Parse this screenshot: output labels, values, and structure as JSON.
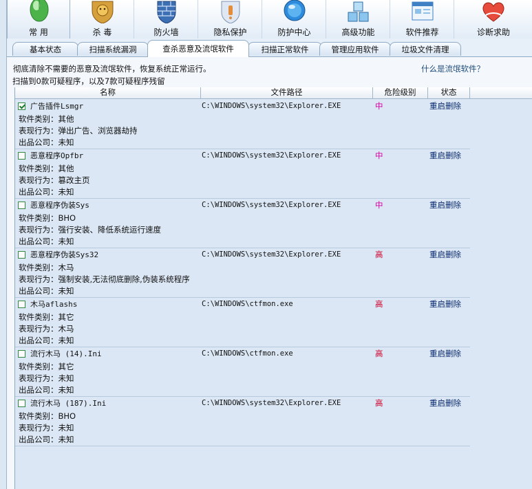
{
  "toolbar": {
    "buttons": [
      {
        "label": "常 用",
        "icon": "mouse-icon",
        "color": "#4cb34a"
      },
      {
        "label": "杀 毒",
        "icon": "lion-shield-icon",
        "color": "#d6a13c"
      },
      {
        "label": "防火墙",
        "icon": "firewall-brick-icon",
        "color": "#3c6fb4"
      },
      {
        "label": "隐私保护",
        "icon": "privacy-shield-icon",
        "color": "#e38c3a"
      },
      {
        "label": "防护中心",
        "icon": "protection-globe-icon",
        "color": "#2e8bdc"
      },
      {
        "label": "高级功能",
        "icon": "cubes-icon",
        "color": "#5aa4d8"
      },
      {
        "label": "软件推荐",
        "icon": "window-icon",
        "color": "#3f7fc4"
      },
      {
        "label": "诊断求助",
        "icon": "help-heart-icon",
        "color": "#e64b3b"
      }
    ]
  },
  "tabs": [
    "基本状态",
    "扫描系统漏洞",
    "查杀恶意及流氓软件",
    "扫描正常软件",
    "管理应用软件",
    "垃圾文件清理"
  ],
  "active_tab": 2,
  "info": {
    "description": "彻底清除不需要的恶意及流氓软件，恢复系统正常运行。",
    "summary": "扫描到0款可疑程序，以及7款可疑程序残留",
    "help_link": "什么是流氓软件？"
  },
  "table": {
    "headers": [
      "名称",
      "文件路径",
      "危险级别",
      "状态"
    ],
    "rows": [
      {
        "checked": true,
        "name": "广告插件Lsmgr",
        "category": "软件类别：其他",
        "behavior": "表现行为：弹出广告、浏览器劫持",
        "company": "出品公司：未知",
        "path": "C:\\WINDOWS\\system32\\Explorer.EXE",
        "risk": "中",
        "risk_level": "mid",
        "status": "重启删除"
      },
      {
        "checked": false,
        "name": "恶意程序Opfbr",
        "category": "软件类别：其他",
        "behavior": "表现行为：篡改主页",
        "company": "出品公司：未知",
        "path": "C:\\WINDOWS\\system32\\Explorer.EXE",
        "risk": "中",
        "risk_level": "mid",
        "status": "重启删除"
      },
      {
        "checked": false,
        "name": "恶意程序伪装Sys",
        "category": "软件类别：BHO",
        "behavior": "表现行为：强行安装、降低系统运行速度",
        "company": "出品公司：未知",
        "path": "C:\\WINDOWS\\system32\\Explorer.EXE",
        "risk": "中",
        "risk_level": "mid",
        "status": "重启删除"
      },
      {
        "checked": false,
        "name": "恶意程序伪装Sys32",
        "category": "软件类别：木马",
        "behavior": "表现行为：强制安装,无法彻底删除,伪装系统程序",
        "company": "出品公司：未知",
        "path": "C:\\WINDOWS\\system32\\Explorer.EXE",
        "risk": "高",
        "risk_level": "high",
        "status": "重启删除"
      },
      {
        "checked": false,
        "name": "木马aflashs",
        "category": "软件类别：其它",
        "behavior": "表现行为：木马",
        "company": "出品公司：未知",
        "path": "C:\\WINDOWS\\ctfmon.exe",
        "risk": "高",
        "risk_level": "high",
        "status": "重启删除"
      },
      {
        "checked": false,
        "name": "流行木马 (14).Ini",
        "category": "软件类别：其它",
        "behavior": "表现行为：未知",
        "company": "出品公司：未知",
        "path": "C:\\WINDOWS\\ctfmon.exe",
        "risk": "高",
        "risk_level": "high",
        "status": "重启删除"
      },
      {
        "checked": false,
        "name": "流行木马 (187).Ini",
        "category": "软件类别：BHO",
        "behavior": "表现行为：未知",
        "company": "出品公司：未知",
        "path": "C:\\WINDOWS\\system32\\Explorer.EXE",
        "risk": "高",
        "risk_level": "high",
        "status": "重启删除"
      }
    ]
  }
}
